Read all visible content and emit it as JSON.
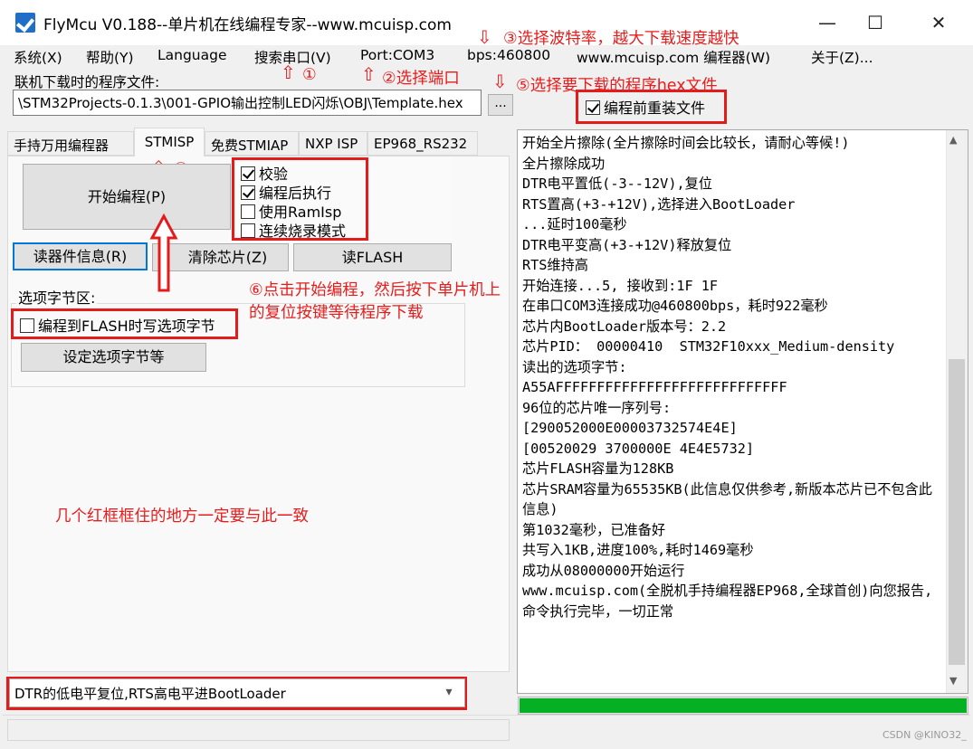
{
  "window": {
    "title": "FlyMcu V0.188--单片机在线编程专家--www.mcuisp.com",
    "controls": {
      "minimize": "—",
      "maximize": "☐",
      "close": "✕"
    }
  },
  "menu": {
    "items": [
      "系统(X)",
      "帮助(Y)",
      "Language",
      "搜索串口(V)",
      "Port:COM3",
      "bps:460800",
      "www.mcuisp.com 编程器(W)",
      "关于(Z)..."
    ]
  },
  "file": {
    "label": "联机下载时的程序文件:",
    "path": "\\STM32Projects-0.1.3\\001-GPIO输出控制LED闪烁\\OBJ\\Template.hex",
    "browse_label": "...",
    "reload_label": "编程前重装文件",
    "reload_checked": true
  },
  "tabs": [
    "手持万用编程器",
    "STMISP",
    "免费STMIAP",
    "NXP ISP",
    "EP968_RS232"
  ],
  "active_tab": "STMISP",
  "stmisp": {
    "start_button": "开始编程(P)",
    "options": [
      {
        "label": "校验",
        "checked": true
      },
      {
        "label": "编程后执行",
        "checked": true
      },
      {
        "label": "使用RamIsp",
        "checked": false
      },
      {
        "label": "连续烧录模式",
        "checked": false
      }
    ],
    "read_info_button": "读器件信息(R)",
    "erase_button": "清除芯片(Z)",
    "read_flash_button": "读FLASH",
    "option_bytes_group": "选项字节区:",
    "write_option_bytes": {
      "label": "编程到FLASH时写选项字节",
      "checked": false
    },
    "set_option_bytes_button": "设定选项字节等"
  },
  "reset_mode": {
    "selected": "DTR的低电平复位,RTS高电平进BootLoader"
  },
  "log": [
    "开始全片擦除(全片擦除时间会比较长，请耐心等候!)",
    "全片擦除成功",
    "DTR电平置低(-3--12V),复位",
    "RTS置高(+3-+12V),选择进入BootLoader",
    "...延时100毫秒",
    "DTR电平变高(+3-+12V)释放复位",
    "RTS维持高",
    "开始连接...5, 接收到:1F 1F",
    "在串口COM3连接成功@460800bps，耗时922毫秒",
    "芯片内BootLoader版本号：2.2",
    "芯片PID： 00000410  STM32F10xxx_Medium-density",
    "读出的选项字节:",
    "A55AFFFFFFFFFFFFFFFFFFFFFFFFFFFF",
    "96位的芯片唯一序列号:",
    "[290052000E00003732574E4E]",
    "[00520029 3700000E 4E4E5732]",
    "芯片FLASH容量为128KB",
    "芯片SRAM容量为65535KB(此信息仅供参考,新版本芯片已不包含此信息)",
    "第1032毫秒，已准备好",
    "共写入1KB,进度100%,耗时1469毫秒",
    "成功从08000000开始运行",
    "www.mcuisp.com(全脱机手持编程器EP968,全球首创)向您报告, 命令执行完毕，一切正常"
  ],
  "progress": {
    "fraction": 1.0,
    "color": "#06b025"
  },
  "annotations": {
    "step1": "①",
    "step2": "②选择端口",
    "step3": "③选择波特率，越大下载速度越快",
    "step4": "④",
    "step5": "⑤选择要下载的程序hex文件",
    "step6": "⑥点击开始编程，然后按下单片机上的复位按键等待程序下载",
    "consistency_note": "几个红框框住的地方一定要与此一致",
    "color": "#e81c1c"
  },
  "watermark": "CSDN @KINO32_"
}
